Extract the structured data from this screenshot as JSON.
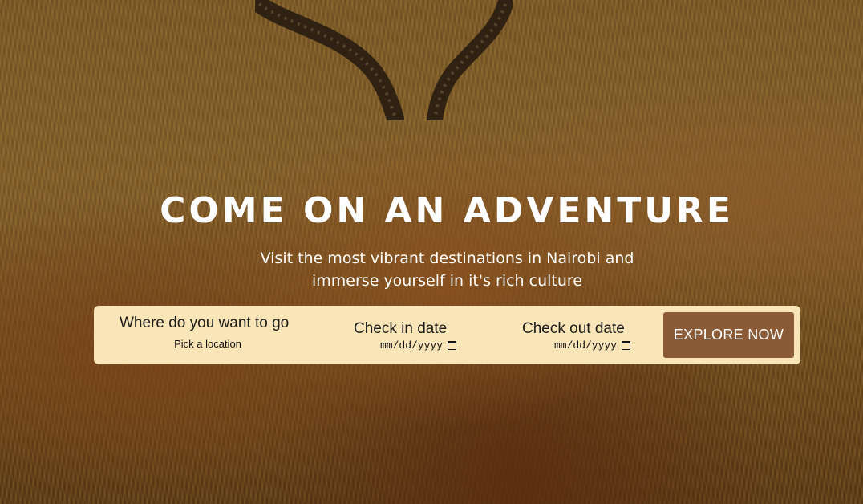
{
  "hero": {
    "title": "COME ON AN ADVENTURE",
    "subtitle": "Visit the most vibrant destinations in Nairobi and immerse yourself in it's rich culture"
  },
  "search": {
    "location_label": "Where do you want to go",
    "location_placeholder": "Pick a location",
    "checkin_label": "Check in date",
    "checkin_value": "mm/dd/yyyy",
    "checkout_label": "Check out date",
    "checkout_value": "mm/dd/yyyy",
    "explore_label": "EXPLORE NOW"
  },
  "colors": {
    "search_bar_bg": "#fae5b9",
    "button_bg": "#8b5a36",
    "text_light": "#ffffff"
  },
  "icons": {
    "date_picker": "calendar-icon"
  }
}
